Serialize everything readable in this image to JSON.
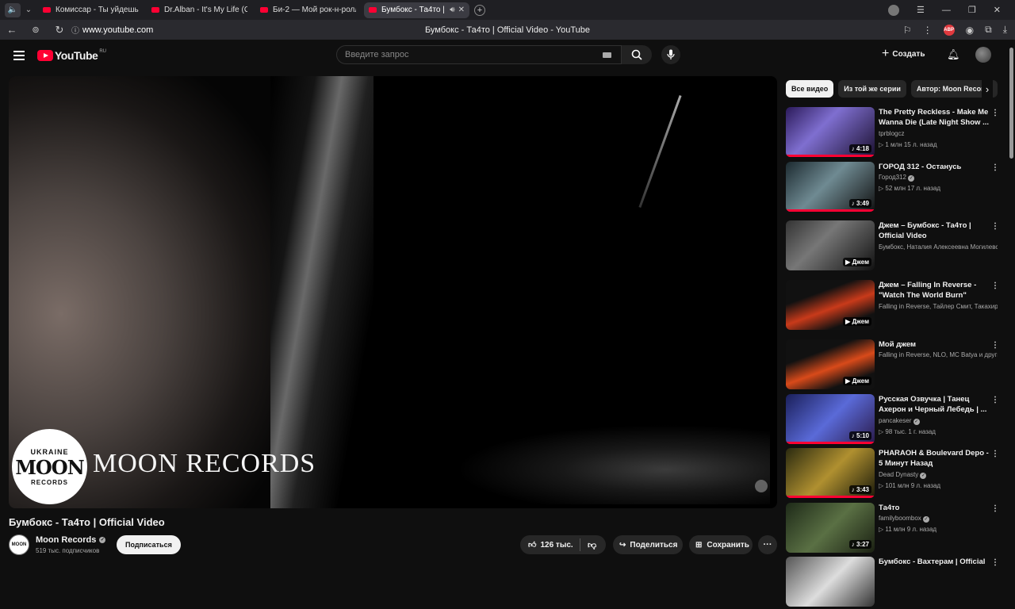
{
  "browser": {
    "tabs": [
      {
        "label": "Комиссар - Ты уйдешь - Y",
        "active": false
      },
      {
        "label": "Dr.Alban - It's My Life (Offi",
        "active": false
      },
      {
        "label": "Би-2 — Мой рок-н-ролл (",
        "active": false
      },
      {
        "label": "Бумбокс - Та4то | Off",
        "active": true
      }
    ],
    "url": "www.youtube.com",
    "page_title": "Бумбокс - Та4то | Official Video - YouTube"
  },
  "header": {
    "logo_text": "YouTube",
    "logo_region": "RU",
    "search_placeholder": "Введите запрос",
    "create_label": "Создать"
  },
  "player": {
    "watermark_top": "UKRAINE",
    "watermark_mid": "MOON",
    "watermark_bottom": "RECORDS",
    "overlay_text": "MOON RECORDS"
  },
  "video": {
    "title": "Бумбокс - Та4то | Official Video",
    "channel": "Moon Records",
    "subscribers": "519 тыс. подписчиков",
    "subscribe_label": "Подписаться",
    "likes": "126 тыс.",
    "share_label": "Поделиться",
    "save_label": "Сохранить"
  },
  "chips": [
    "Все видео",
    "Из той же серии",
    "Автор: Moon Records"
  ],
  "recommendations": [
    {
      "title": "The Pretty Reckless - Make Me Wanna Die (Late Night Show ...",
      "channel": "tprblogcz",
      "verified": false,
      "meta": "▷ 1 млн   15 л. назад",
      "duration": "♪ 4:18",
      "progress": 1.0,
      "thumb": "linear-gradient(135deg,#2b1a5a,#7f6fd0 40%,#1b1030)"
    },
    {
      "title": "ГОРОД 312 - Останусь",
      "channel": "Город312",
      "verified": true,
      "meta": "▷ 52 млн   17 л. назад",
      "duration": "♪ 3:49",
      "progress": 1.0,
      "thumb": "linear-gradient(135deg,#1c2a30,#6f8a92 45%,#111)"
    },
    {
      "title": "Джем – Бумбокс - Та4то | Official Video",
      "channel": "Бумбокс, Наталия Алексеевна Могилевская, Потап...",
      "verified": false,
      "meta": "",
      "duration": "▶ Джем",
      "progress": 0,
      "thumb": "linear-gradient(135deg,#333,#777 40%,#111)"
    },
    {
      "title": "Джем – Falling In Reverse - \"Watch The World Burn\"",
      "channel": "Falling in Reverse, Тайлер Смит, Такахиро Моирта...",
      "verified": false,
      "meta": "",
      "duration": "▶ Джем",
      "progress": 0,
      "thumb": "linear-gradient(160deg,#111 30%,#c83a1a 55%,#111 80%)"
    },
    {
      "title": "Мой джем",
      "channel": "Falling in Reverse, NLO, MC Batya и другие",
      "verified": false,
      "meta": "",
      "duration": "▶ Джем",
      "progress": 0,
      "thumb": "linear-gradient(160deg,#111 30%,#d84a1a 55%,#111 80%)"
    },
    {
      "title": "Русская Озвучка | Танец Ахерон и Черный Лебедь | ...",
      "channel": "pancakeser",
      "verified": true,
      "meta": "▷ 98 тыс.   1 г. назад",
      "duration": "♪ 5:10",
      "progress": 1.0,
      "thumb": "linear-gradient(135deg,#1a1f5a,#5a6ad8 50%,#2a1a4a)"
    },
    {
      "title": "PHARAOH & Boulevard Depo - 5 Минут Назад",
      "channel": "Dead Dynasty",
      "verified": true,
      "meta": "▷ 101 млн   9 л. назад",
      "duration": "♪ 3:43",
      "progress": 1.0,
      "thumb": "linear-gradient(135deg,#2a2a10,#b09030 50%,#1a1a0a)"
    },
    {
      "title": "Та4то",
      "channel": "familyboombox",
      "verified": true,
      "meta": "▷ 11 млн   9 л. назад",
      "duration": "♪ 3:27",
      "progress": 0,
      "thumb": "linear-gradient(135deg,#1e2a18,#5a7044 50%,#1a2012)"
    },
    {
      "title": "Бумбокс - Вахтерам | Official",
      "channel": "",
      "verified": false,
      "meta": "",
      "duration": "",
      "progress": 0,
      "thumb": "linear-gradient(135deg,#555,#ddd 50%,#333)"
    }
  ]
}
